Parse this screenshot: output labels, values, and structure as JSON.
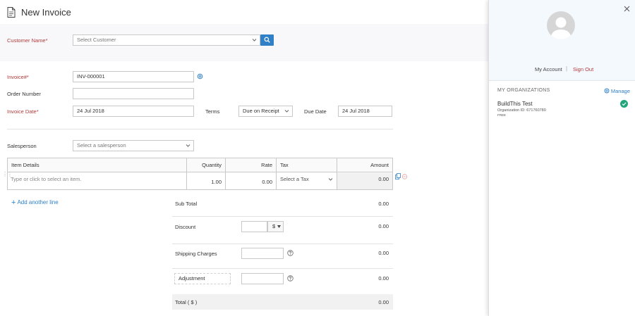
{
  "page": {
    "title": "New Invoice"
  },
  "customer": {
    "label": "Customer Name*",
    "placeholder": "Select Customer"
  },
  "invoice_number": {
    "label": "Invoice#*",
    "value": "INV-000001"
  },
  "order_number": {
    "label": "Order Number",
    "value": ""
  },
  "invoice_date": {
    "label": "Invoice Date*",
    "value": "24 Jul 2018"
  },
  "terms": {
    "label": "Terms",
    "value": "Due on Receipt"
  },
  "due_date": {
    "label": "Due Date",
    "value": "24 Jul 2018"
  },
  "salesperson": {
    "label": "Salesperson",
    "placeholder": "Select a salesperson"
  },
  "items_table": {
    "headers": [
      "Item Details",
      "Quantity",
      "Rate",
      "Tax",
      "Amount"
    ],
    "rows": [
      {
        "item_placeholder": "Type or click to select an item.",
        "quantity": "1.00",
        "rate": "0.00",
        "tax_placeholder": "Select a Tax",
        "amount": "0.00"
      }
    ]
  },
  "add_line_label": "Add another line",
  "totals": {
    "subtotal_label": "Sub Total",
    "subtotal_value": "0.00",
    "discount_label": "Discount",
    "discount_unit": "$",
    "discount_value": "0.00",
    "shipping_label": "Shipping Charges",
    "shipping_value": "0.00",
    "adjustment_label": "Adjustment",
    "adjustment_value": "0.00",
    "total_label": "Total ( $ )",
    "total_value": "0.00"
  },
  "account_panel": {
    "my_account": "My Account",
    "separator": "|",
    "sign_out": "Sign Out",
    "organizations_heading": "MY ORGANIZATIONS",
    "manage": "Manage",
    "org": {
      "name": "BuildThis Test",
      "id_text": "Organization ID: 671760780",
      "plan": "FREE"
    }
  },
  "colors": {
    "accent_blue": "#2f80c6",
    "required_red": "#b03c3c",
    "success_green": "#1fa67a",
    "panel_bg": "#f4f9fd"
  }
}
